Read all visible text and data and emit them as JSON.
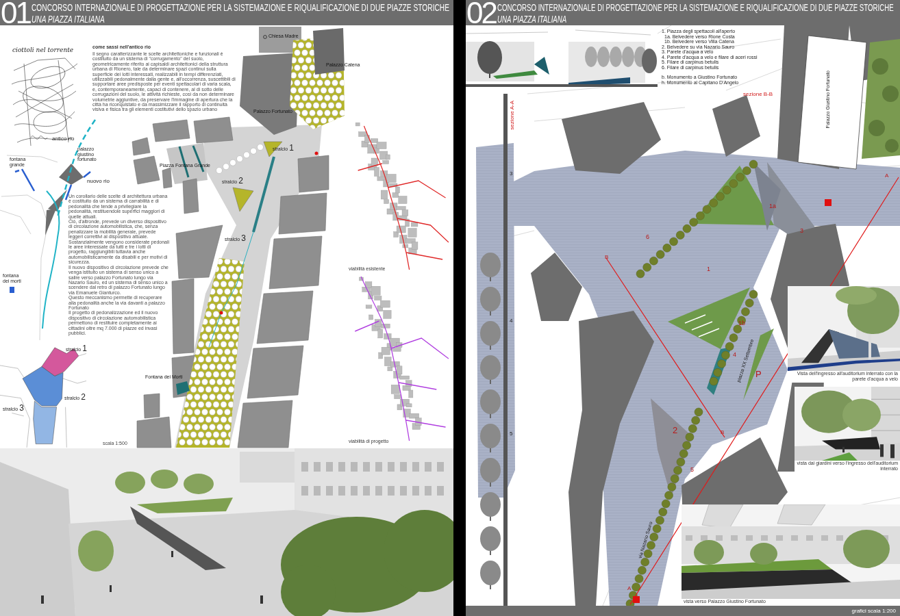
{
  "left_board": {
    "number": "01",
    "title": "CONCORSO INTERNAZIONALE DI PROGETTAZIONE PER LA SISTEMAZIONE E RIQUALIFICAZIONE DI DUE PIAZZE STORICHE",
    "subtitle": "UNA PIAZZA ITALIANA",
    "sketch_note": "ciottoli nel torrente",
    "concept_labels": [
      "antico rio",
      "palazzo giustino fortunato",
      "nuovo rio",
      "fontana grande",
      "fontana dei morti"
    ],
    "intro": {
      "heading": "come sassi nell'antico rio",
      "text": "Il segno caratterizzante le scelte architettoniche e funzionali è costituito da un sistema di \"corrugamento\" del suolo, geometricamente riferito ai capisaldi architettonici della struttura urbana di Rionero, tale da determinare spazi continui sulla superficie dei lotti interessati, realizzabili in tempi differenziati, utilizzabili pedonalmente dalla gente e, all'occorrenza, suscettibili di supportare aree predisposte per eventi spettacolari di varia scala, e, contemporaneamente, capaci di contenere, al di sotto delle corrugazioni del suolo, le attività richieste, così da non determinare volumetrie aggiuntive, da preservare l'immagine di apertura che la città ha riconquistato e da massimizzare il rapporto di continuità visiva e fisica tra gli elementi costitutivi dello spazio urbano"
    },
    "mobility_text": "Un corollario delle scelte di architettura urbana è costituito da un sistema di carrabilità e di pedonalità che tende a privilegiare la pedonalità, restituendole superfici maggiori di quelle attuali.\nCiò, d'altronde, prevede un diverso dispositivo di circolazione automobilistica, che, senza penalizzare la mobilità generale, prevede leggeri correttivi al dispositivo attuale.\nSostanzialmente vengono considerate pedonali le aree interessate da tutti e tre i lotti di progetto, raggiungibili tuttavia anche automobilisticamente da disabili e per motivi di sicurezza.\nIl nuovo dispositivo di circolazione prevede che venga istituito un sistema di senso unico a salire verso palazzo Fortunato lungo via Nazario Sauro, ed un sistema di senso unico a scendere dal retro di palazzo Fortunato lungo via Emanuele Gianturco.\nQuesto meccanismo permette di recuperare alla pedonalità anche la via davanti a palazzo Fortunato\nIl progetto di pedonalizzazione ed il nuovo dispositivo di circolazione automobilistica permettono di restituire completamente ai cittadini oltre mq 7.000 di piazze ed invasi pubblici.",
    "phases": [
      {
        "label": "stralcio",
        "number": "1",
        "color": "#d4589c"
      },
      {
        "label": "stralcio",
        "number": "2",
        "color": "#5b8ed6"
      },
      {
        "label": "stralcio",
        "number": "3",
        "color": "#92b6e4"
      }
    ],
    "plan_labels": [
      "Chiesa Madre",
      "Palazzo Catena",
      "Palazzo Fortunato",
      "Piazza Fontana Grande",
      "Fontana dei Morti"
    ],
    "plan_phases": [
      {
        "label": "stralcio",
        "number": "1"
      },
      {
        "label": "stralcio",
        "number": "2"
      },
      {
        "label": "stralcio",
        "number": "3"
      }
    ],
    "scale": "scala 1:500",
    "traffic_maps": [
      {
        "caption": "viabilità esistente",
        "color": "#e02828"
      },
      {
        "caption": "viabilità di progetto",
        "color": "#b03ee0"
      }
    ]
  },
  "right_board": {
    "number": "02",
    "title": "CONCORSO INTERNAZIONALE DI PROGETTAZIONE PER LA SISTEMAZIONE E RIQUALIFICAZIONE DI DUE PIAZZE STORICHE",
    "subtitle": "UNA PIAZZA ITALIANA",
    "legend": [
      {
        "text": "1. Piazza degli spettacoli all'aperto",
        "children": [
          {
            "text": "1a. Belvedere verso Rione Costa"
          },
          {
            "text": "1b. Belvedere verso Villa Catena"
          }
        ]
      },
      {
        "text": "2. Belvedere su via Nazario Sauro"
      },
      {
        "text": "3. Parete d'acqua a velo"
      },
      {
        "text": "4. Parete d'acqua a velo e filare di aceri rossi"
      },
      {
        "text": "5. Filare di carpinus betulis"
      },
      {
        "text": "6. Filare di carpinus betulis"
      }
    ],
    "monuments": [
      "b. Monumento a Giustino Fortunato",
      "h. Monumento al Capitano D'Angelo"
    ],
    "sections": [
      "sezione B-B",
      "sezione A-A"
    ],
    "building_label": "Palazzo Giustino Fortunato",
    "plan_labels": [
      "1",
      "1a",
      "1b",
      "2",
      "3",
      "4",
      "5",
      "6",
      "P"
    ],
    "street_labels": [
      "piazza XX Settembre",
      "via Nazario Sauro"
    ],
    "section_marks": [
      "A",
      "A",
      "B",
      "B"
    ],
    "section_numbers": [
      "3",
      "4",
      "5"
    ],
    "views": [
      {
        "caption": "Vista dell'ingresso all'auditorium interrato con la parete d'acqua a velo"
      },
      {
        "caption": "vista dai giardini verso l'ingresso dell'auditorium interrato"
      },
      {
        "caption": "vista verso Palazzo Giustino Fortunato"
      }
    ],
    "scale": "grafici scala 1:200"
  }
}
